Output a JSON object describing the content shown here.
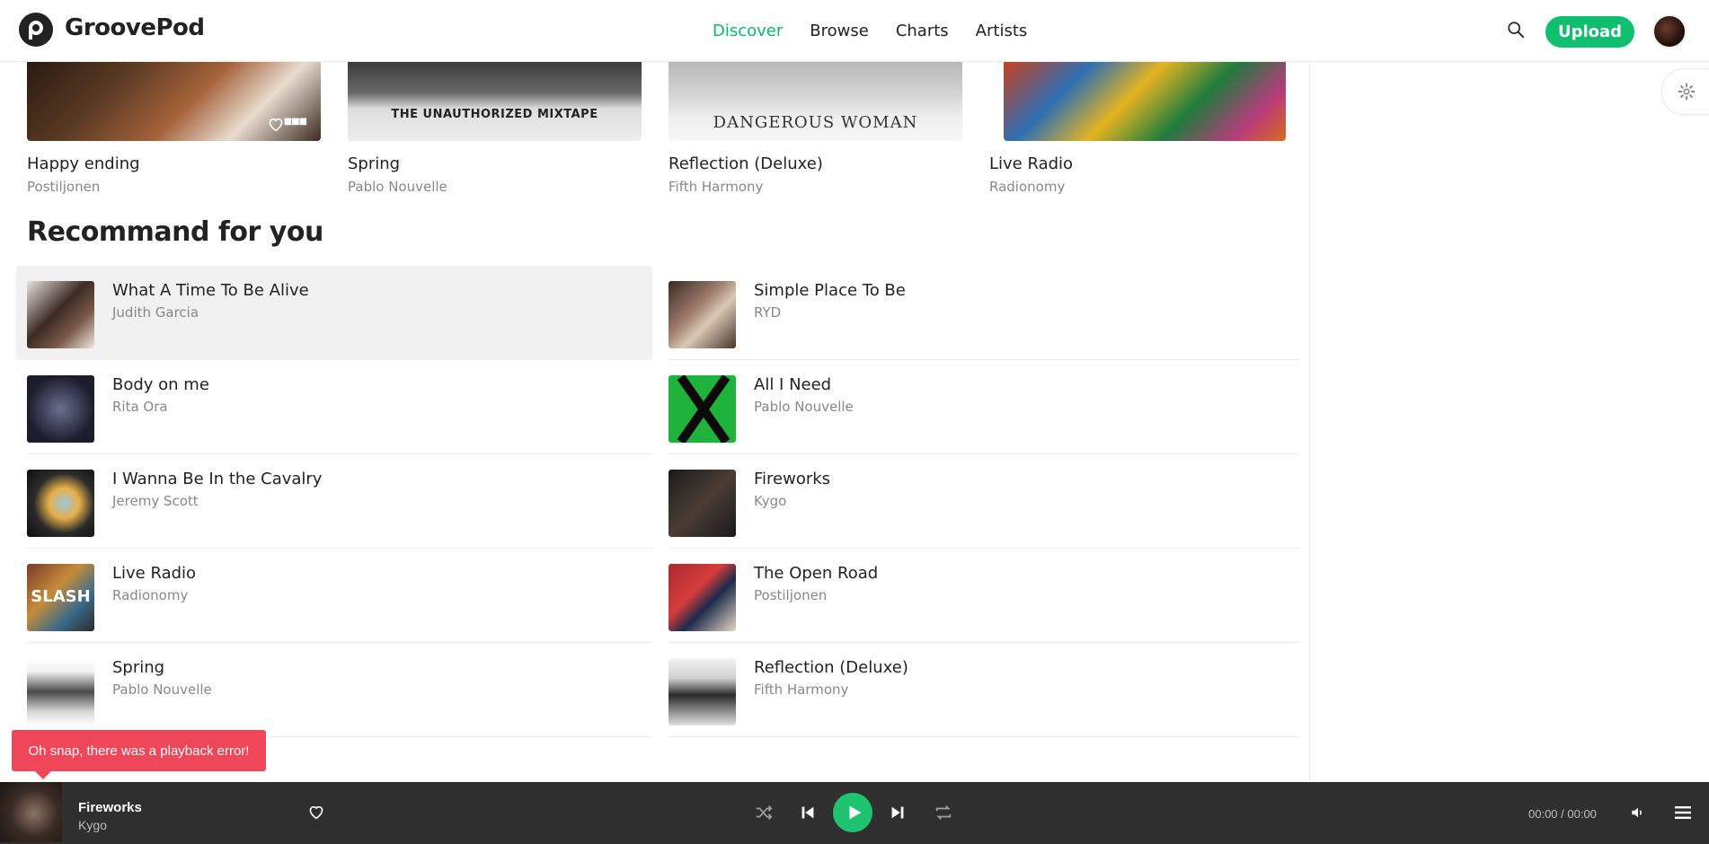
{
  "header": {
    "brand": "GroovePod",
    "nav": [
      "Discover",
      "Browse",
      "Charts",
      "Artists"
    ],
    "active_nav": "Discover",
    "upload_label": "Upload"
  },
  "albums": [
    {
      "title": "Happy ending",
      "artist": "Postiljonen",
      "cover_text": ""
    },
    {
      "title": "Spring",
      "artist": "Pablo Nouvelle",
      "cover_text": "THE UNAUTHORIZED MIXTAPE"
    },
    {
      "title": "Reflection (Deluxe)",
      "artist": "Fifth Harmony",
      "cover_text": "DANGEROUS WOMAN"
    },
    {
      "title": "Live Radio",
      "artist": "Radionomy",
      "cover_text": ""
    }
  ],
  "section_title": "Recommand for you",
  "recommend_left": [
    {
      "title": "What A Time To Be Alive",
      "artist": "Judith Garcia"
    },
    {
      "title": "Body on me",
      "artist": "Rita Ora"
    },
    {
      "title": "I Wanna Be In the Cavalry",
      "artist": "Jeremy Scott"
    },
    {
      "title": "Live Radio",
      "artist": "Radionomy"
    },
    {
      "title": "Spring",
      "artist": "Pablo Nouvelle"
    }
  ],
  "recommend_right": [
    {
      "title": "Simple Place To Be",
      "artist": "RYD"
    },
    {
      "title": "All I Need",
      "artist": "Pablo Nouvelle"
    },
    {
      "title": "Fireworks",
      "artist": "Kygo"
    },
    {
      "title": "The Open Road",
      "artist": "Postiljonen"
    },
    {
      "title": "Reflection (Deluxe)",
      "artist": "Fifth Harmony"
    }
  ],
  "thumb_texts": {
    "live_radio": "SLASH"
  },
  "toast": {
    "message": "Oh snap, there was a playback error!"
  },
  "player": {
    "title": "Fireworks",
    "artist": "Kygo",
    "time": "00:00 / 00:00",
    "progress": 0.0
  },
  "colors": {
    "accent": "#0fbf6f",
    "toast": "#f0465a",
    "player_bg": "#2f2f30"
  },
  "icons": [
    "search-icon",
    "gear-icon",
    "heart-icon",
    "shuffle-icon",
    "previous-icon",
    "play-icon",
    "next-icon",
    "repeat-icon",
    "volume-icon",
    "menu-icon"
  ]
}
